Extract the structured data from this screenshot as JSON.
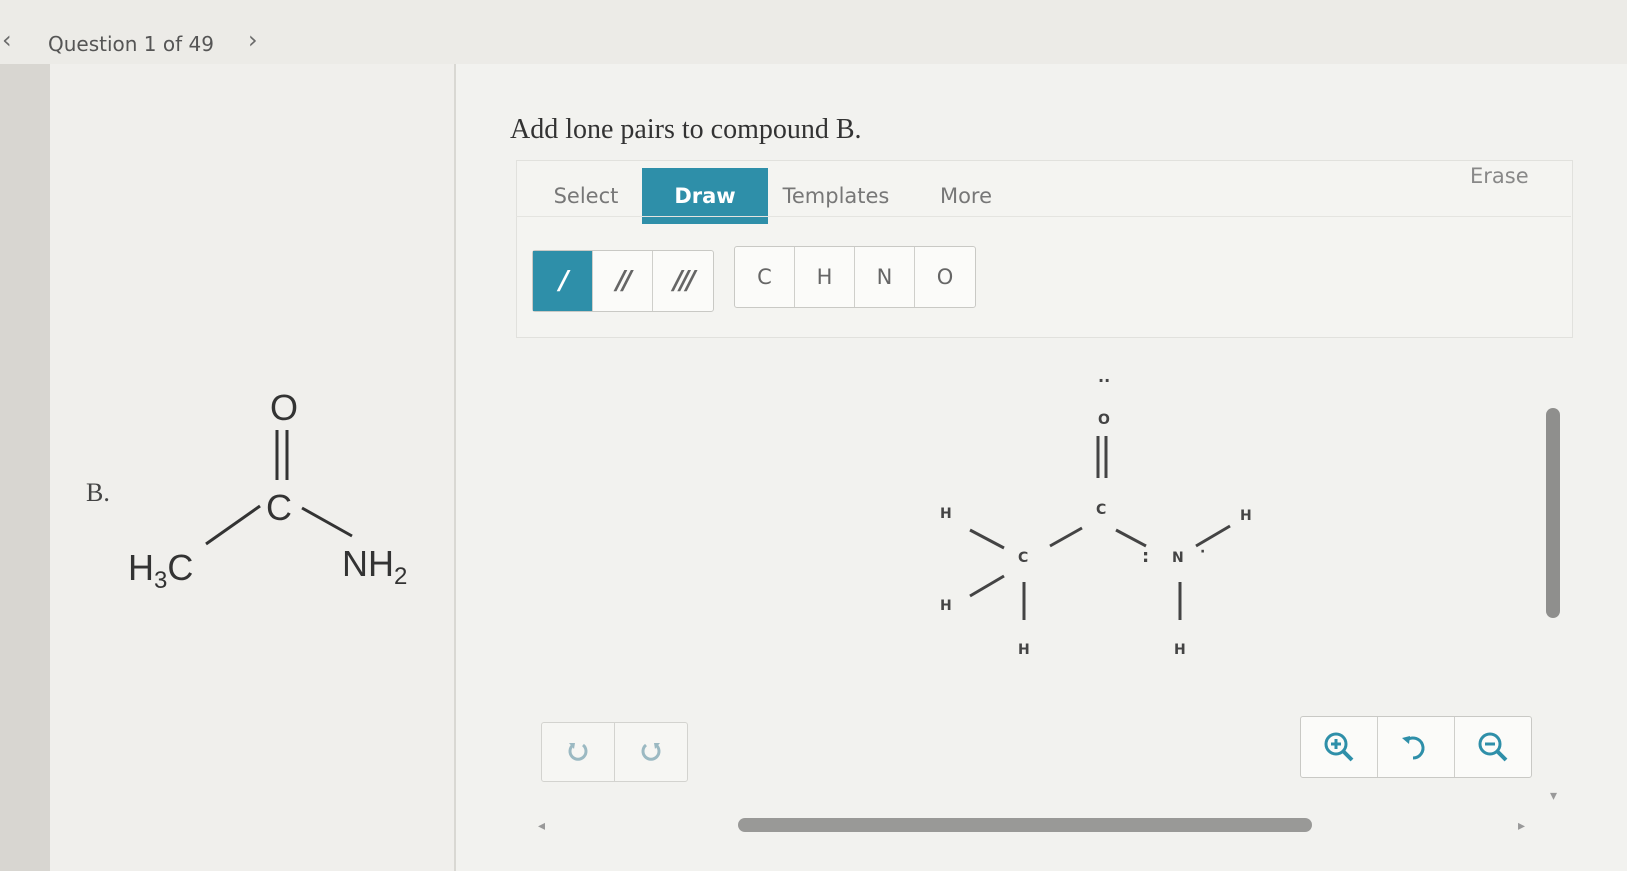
{
  "nav": {
    "prev_icon": "chevron-left-icon",
    "next_icon": "chevron-right-icon",
    "question_label": "Question 1 of 49"
  },
  "question": {
    "prompt": "Add lone pairs to compound B.",
    "compound_label": "B.",
    "structure_labels": {
      "oxygen": "O",
      "carbon": "C",
      "methyl": "H",
      "methyl_sub": "3",
      "methyl_c": "C",
      "amine": "NH",
      "amine_sub": "2"
    }
  },
  "editor": {
    "tabs": [
      "Select",
      "Draw",
      "Templates",
      "More"
    ],
    "active_tab": "Draw",
    "erase_label": "Erase",
    "bond_tools": [
      {
        "icon": "single-bond-icon",
        "glyph": "/"
      },
      {
        "icon": "double-bond-icon",
        "glyph": "//"
      },
      {
        "icon": "triple-bond-icon",
        "glyph": "///"
      }
    ],
    "active_bond": "single-bond-icon",
    "atom_tools": [
      "C",
      "H",
      "N",
      "O"
    ],
    "accent_color": "#2e8fa9"
  },
  "canvas": {
    "atoms": {
      "o": "O",
      "c_carbonyl": "C",
      "c_methyl": "C",
      "n": "N",
      "h_top_left": "H",
      "h_left": "H",
      "h_bottom_c": "H",
      "h_top_right": "H",
      "h_bottom_n": "H"
    },
    "lone_pair_glyph": ":"
  },
  "controls": {
    "undo_icon": "undo-icon",
    "redo_icon": "redo-icon",
    "zoom_in_icon": "zoom-in-icon",
    "zoom_reset_icon": "zoom-reset-icon",
    "zoom_out_icon": "zoom-out-icon"
  }
}
